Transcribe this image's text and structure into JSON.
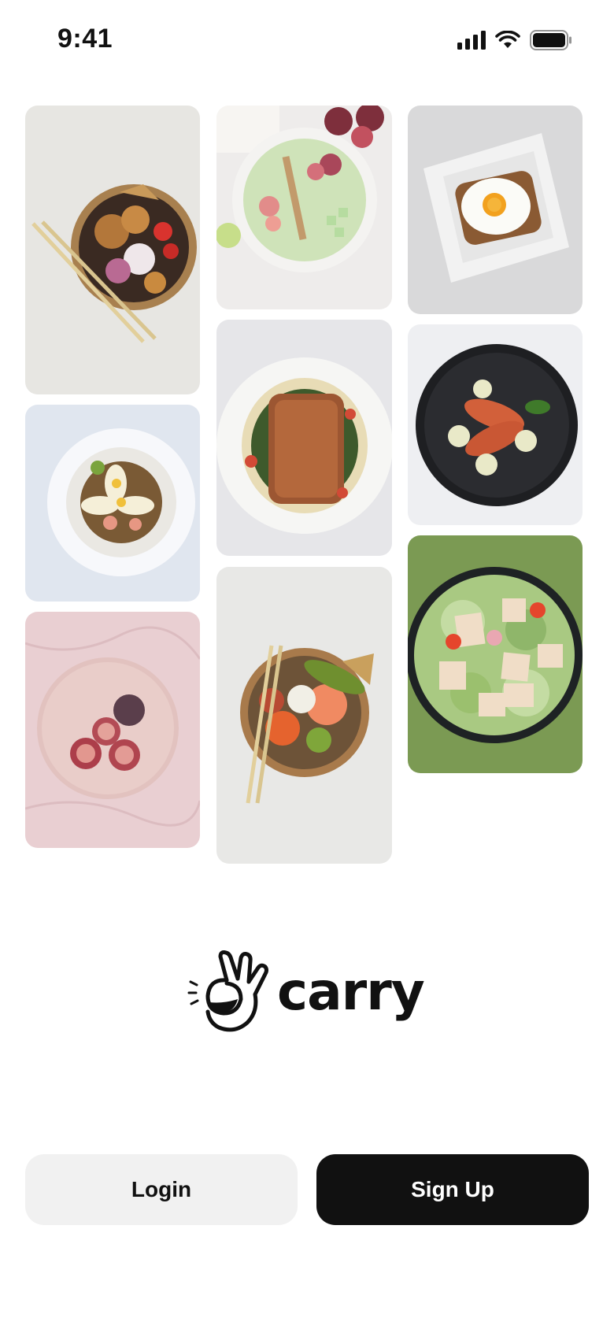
{
  "status_bar": {
    "time": "9:41",
    "icons": [
      "cellular-signal-icon",
      "wifi-icon",
      "battery-icon"
    ]
  },
  "gallery": {
    "photos": [
      {
        "name": "chicken-rice-bowl",
        "bg": "#e7e6e2"
      },
      {
        "name": "fig-smoothie-bowl",
        "bg": "#eeeceb"
      },
      {
        "name": "egg-toast-plate",
        "bg": "#d9d9da"
      },
      {
        "name": "salmon-fillet-plate",
        "bg": "#e6e6e9"
      },
      {
        "name": "shrimp-black-plate",
        "bg": "#eeeff2"
      },
      {
        "name": "noodle-egg-plate",
        "bg": "#e0e6ef"
      },
      {
        "name": "poke-bowl",
        "bg": "#e8e8e6"
      },
      {
        "name": "green-salad-bowl",
        "bg": "#7b9a53"
      },
      {
        "name": "figs-pink-plate",
        "bg": "#e9cfd2"
      }
    ]
  },
  "brand": {
    "name": "carry",
    "logo_icon": "ok-hand-icon"
  },
  "actions": {
    "login_label": "Login",
    "signup_label": "Sign Up"
  },
  "colors": {
    "primary_button": "#111111",
    "secondary_button": "#f1f1f1",
    "background": "#ffffff"
  }
}
